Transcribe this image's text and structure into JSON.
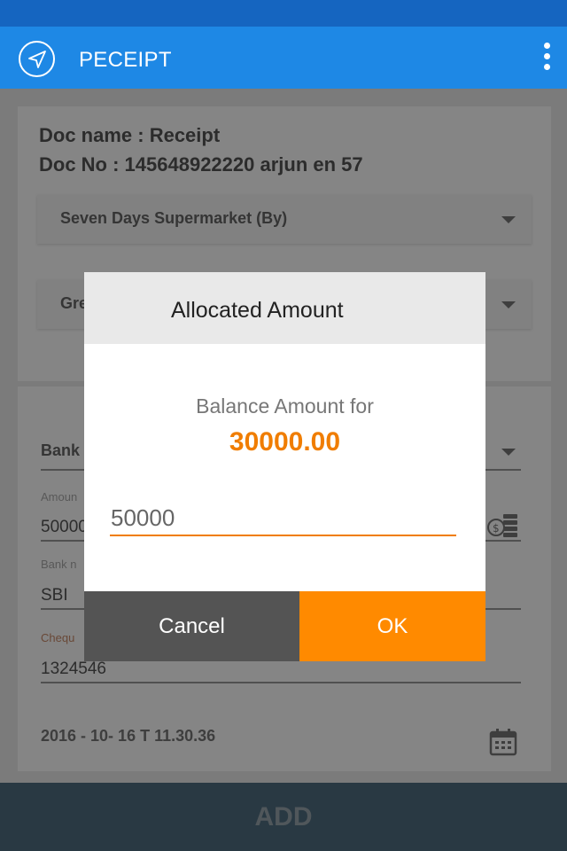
{
  "app": {
    "title": "PECEIPT"
  },
  "doc": {
    "name_line": "Doc name : Receipt",
    "no_line": "Doc No : 145648922220 arjun en 57"
  },
  "selects": {
    "customer": "Seven Days Supermarket (By)",
    "second": "Gre"
  },
  "form": {
    "payment_mode": "Bank",
    "amount_label": "Amoun",
    "amount_value": "50000",
    "bank_label": "Bank n",
    "bank_value": "SBI",
    "cheque_label": "Chequ",
    "cheque_value": "1324546",
    "datetime": "2016 - 10- 16  T 11.30.36"
  },
  "footer": {
    "add_label": "ADD"
  },
  "dialog": {
    "title": "Allocated Amount",
    "balance_label": "Balance Amount for",
    "balance_amount": "30000.00",
    "input_value": "50000",
    "cancel_label": "Cancel",
    "ok_label": "OK"
  },
  "colors": {
    "primary": "#1e88e5",
    "status": "#1565c0",
    "accent": "#ff8a00",
    "footer": "#4f6d80"
  },
  "icons": {
    "nav": "send-arrow-icon",
    "more": "more-vertical-icon",
    "coins": "coins-icon",
    "calendar": "calendar-icon"
  }
}
